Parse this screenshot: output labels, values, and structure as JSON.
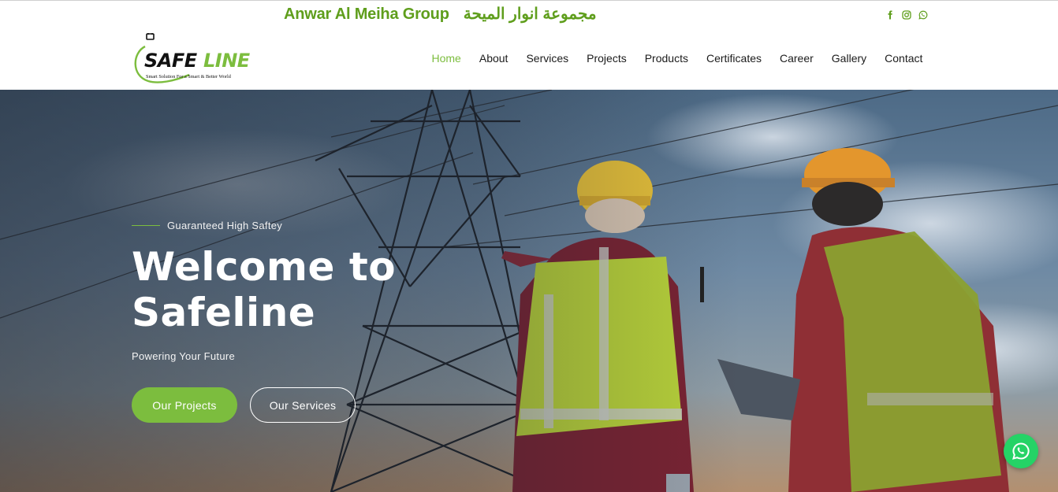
{
  "topbar": {
    "group_name_en": "Anwar Al  Meiha Group",
    "group_name_ar": "مجموعة انوار الميحة",
    "social": [
      "facebook-icon",
      "instagram-icon",
      "whatsapp-icon"
    ]
  },
  "logo": {
    "brand": "SAFELINE",
    "slogan": "Smart Solution For a Smart & Better World"
  },
  "nav": {
    "items": [
      "Home",
      "About",
      "Services",
      "Projects",
      "Products",
      "Certificates",
      "Career",
      "Gallery",
      "Contact"
    ],
    "active": "Home"
  },
  "hero": {
    "tagline": "Guaranteed High Saftey",
    "title_line1": "Welcome to",
    "title_line2": "Safeline",
    "subtitle": "Powering Your Future",
    "primary_button": "Our Projects",
    "secondary_button": "Our Services"
  },
  "colors": {
    "accent": "#7cbd3e",
    "group_title": "#5f9e1c",
    "whatsapp": "#25d366"
  }
}
